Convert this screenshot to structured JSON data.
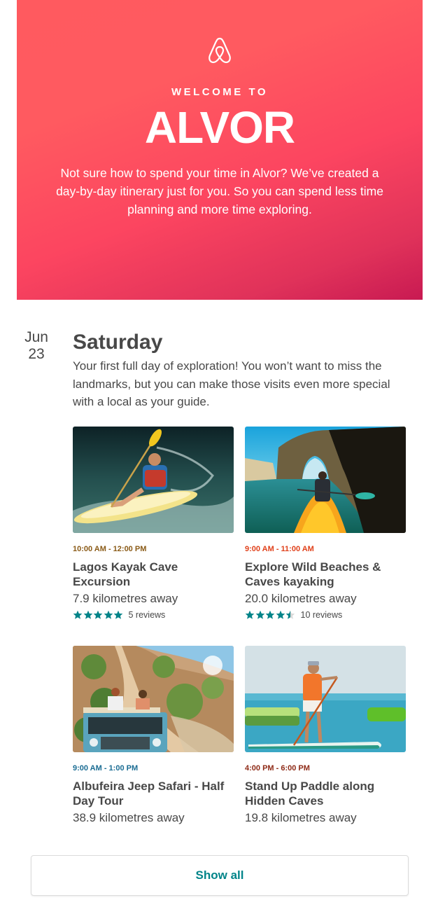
{
  "hero": {
    "logo_icon": "airbnb-belo-icon",
    "welcome": "WELCOME TO",
    "city": "ALVOR",
    "intro": "Not sure how to spend your time in Alvor? We’ve created a day-by-day itinerary just for you. So you can spend less time planning and more time exploring.",
    "gradient_colors": [
      "#ff5a5f",
      "#fc4560",
      "#c81a52"
    ]
  },
  "day": {
    "month": "Jun",
    "date": "23",
    "title": "Saturday",
    "description": "Your first full day of exploration! You won’t want to miss the landmarks, but you can make those visits even more special with a local as your guide."
  },
  "experiences": [
    {
      "time": "10:00 AM - 12:00 PM",
      "time_color": "#8a5a16",
      "title": "Lagos Kayak Cave Excursion",
      "distance": "7.9 kilometres away",
      "rating": 5,
      "reviews": "5 reviews",
      "image": "man-kayaking-yellow-kayak-photo"
    },
    {
      "time": "9:00 AM - 11:00 AM",
      "time_color": "#e0401a",
      "title": "Explore Wild Beaches & Caves kayaking",
      "distance": "20.0 kilometres away",
      "rating": 4.5,
      "reviews": "10 reviews",
      "image": "kayak-sea-arch-photo"
    },
    {
      "time": "9:00 AM - 1:00 PM",
      "time_color": "#1a6c93",
      "title": "Albufeira Jeep Safari - Half Day Tour",
      "distance": "38.9 kilometres away",
      "image": "jeep-safari-dirt-road-photo"
    },
    {
      "time": "4:00 PM - 6:00 PM",
      "time_color": "#8e2a16",
      "title": "Stand Up Paddle along Hidden Caves",
      "distance": "19.8 kilometres away",
      "image": "stand-up-paddle-photo"
    }
  ],
  "star_color": "#008489",
  "star_empty_color": "#d8d8d8",
  "show_all_label": "Show all",
  "accent": "#008489"
}
